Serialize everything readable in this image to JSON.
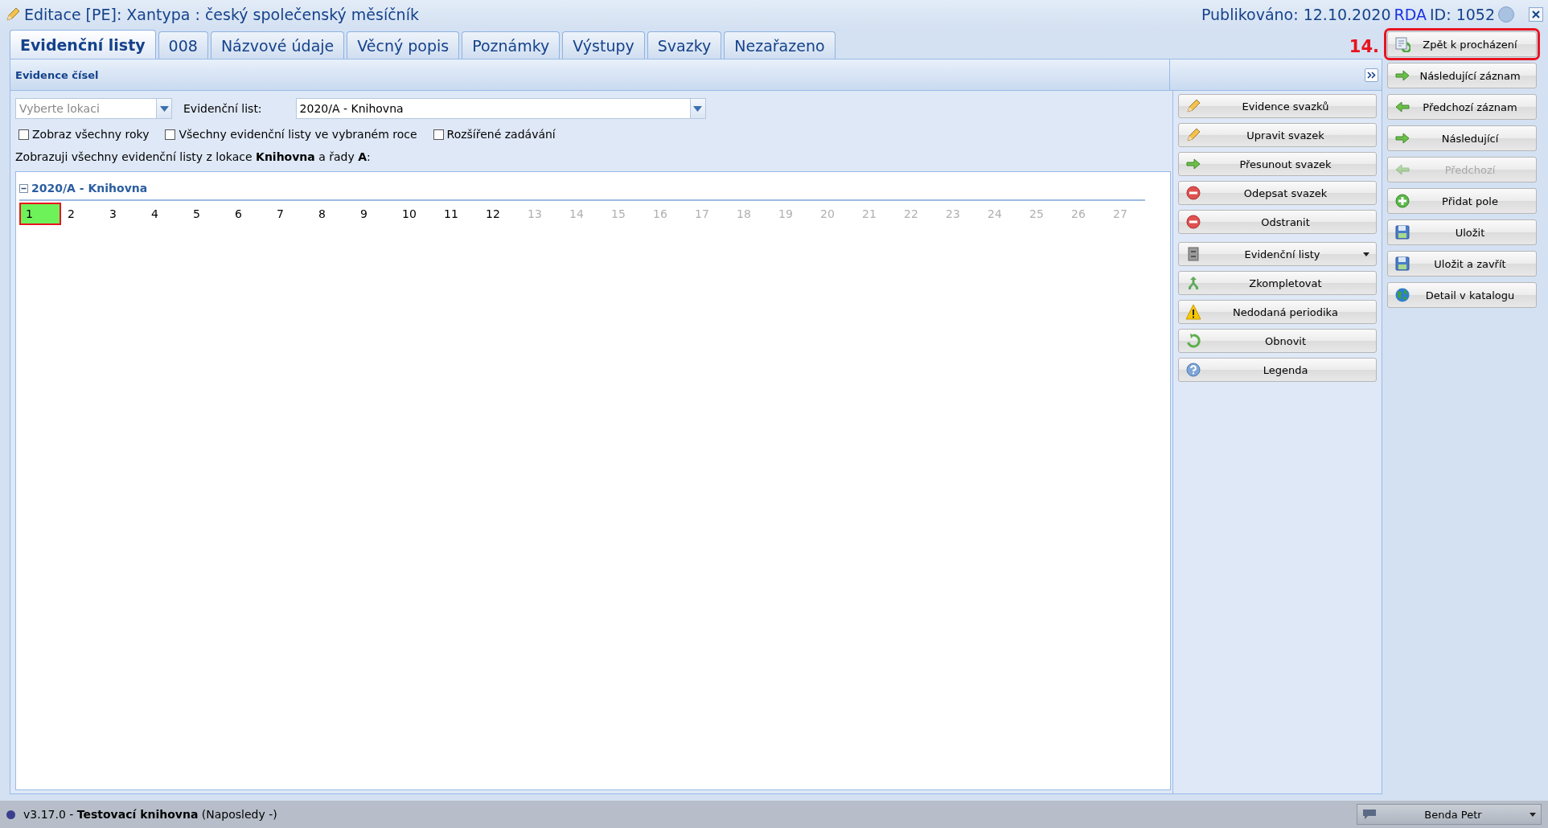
{
  "window": {
    "title": "Editace [PE]: Xantypa : český společenský měsíčník",
    "published": "Publikováno: 12.10.2020",
    "rda": "RDA",
    "record_id": "ID: 1052"
  },
  "tabs": [
    {
      "label": "Evidenční listy",
      "selected": true
    },
    {
      "label": "008",
      "selected": false
    },
    {
      "label": "Názvové údaje",
      "selected": false
    },
    {
      "label": "Věcný popis",
      "selected": false
    },
    {
      "label": "Poznámky",
      "selected": false
    },
    {
      "label": "Výstupy",
      "selected": false
    },
    {
      "label": "Svazky",
      "selected": false
    },
    {
      "label": "Nezařazeno",
      "selected": false
    }
  ],
  "step_label": "14.",
  "panel": {
    "title": "Evidence čísel",
    "location": {
      "placeholder": "Vyberte lokaci"
    },
    "list_label": "Evidenční list:",
    "list_value": "2020/A - Knihovna",
    "checkboxes": [
      {
        "label": "Zobraz všechny roky",
        "checked": false
      },
      {
        "label": "Všechny evidenční listy ve vybraném roce",
        "checked": false
      },
      {
        "label": "Rozšířené zadávání",
        "checked": false
      }
    ],
    "info": "Zobrazuji všechny evidenční listy z lokace **Knihovna** a řady **A**:",
    "group": {
      "label": "2020/A - Knihovna",
      "expanded": true,
      "issues": [
        {
          "label": "1",
          "selected": true,
          "disabled": false,
          "highlighted": true
        },
        {
          "label": "2",
          "selected": false,
          "disabled": false,
          "highlighted": false
        },
        {
          "label": "3",
          "selected": false,
          "disabled": false,
          "highlighted": false
        },
        {
          "label": "4",
          "selected": false,
          "disabled": false,
          "highlighted": false
        },
        {
          "label": "5",
          "selected": false,
          "disabled": false,
          "highlighted": false
        },
        {
          "label": "6",
          "selected": false,
          "disabled": false,
          "highlighted": false
        },
        {
          "label": "7",
          "selected": false,
          "disabled": false,
          "highlighted": false
        },
        {
          "label": "8",
          "selected": false,
          "disabled": false,
          "highlighted": false
        },
        {
          "label": "9",
          "selected": false,
          "disabled": false,
          "highlighted": false
        },
        {
          "label": "10",
          "selected": false,
          "disabled": false,
          "highlighted": false
        },
        {
          "label": "11",
          "selected": false,
          "disabled": false,
          "highlighted": false
        },
        {
          "label": "12",
          "selected": false,
          "disabled": false,
          "highlighted": false
        },
        {
          "label": "13",
          "selected": false,
          "disabled": true,
          "highlighted": false
        },
        {
          "label": "14",
          "selected": false,
          "disabled": true,
          "highlighted": false
        },
        {
          "label": "15",
          "selected": false,
          "disabled": true,
          "highlighted": false
        },
        {
          "label": "16",
          "selected": false,
          "disabled": true,
          "highlighted": false
        },
        {
          "label": "17",
          "selected": false,
          "disabled": true,
          "highlighted": false
        },
        {
          "label": "18",
          "selected": false,
          "disabled": true,
          "highlighted": false
        },
        {
          "label": "19",
          "selected": false,
          "disabled": true,
          "highlighted": false
        },
        {
          "label": "20",
          "selected": false,
          "disabled": true,
          "highlighted": false
        },
        {
          "label": "21",
          "selected": false,
          "disabled": true,
          "highlighted": false
        },
        {
          "label": "22",
          "selected": false,
          "disabled": true,
          "highlighted": false
        },
        {
          "label": "23",
          "selected": false,
          "disabled": true,
          "highlighted": false
        },
        {
          "label": "24",
          "selected": false,
          "disabled": true,
          "highlighted": false
        },
        {
          "label": "25",
          "selected": false,
          "disabled": true,
          "highlighted": false
        },
        {
          "label": "26",
          "selected": false,
          "disabled": true,
          "highlighted": false
        },
        {
          "label": "27",
          "selected": false,
          "disabled": true,
          "highlighted": false
        }
      ]
    }
  },
  "side_actions": [
    [
      {
        "label": "Evidence svazků",
        "kind": "pencil"
      },
      {
        "label": "Upravit svazek",
        "kind": "pencil"
      },
      {
        "label": "Přesunout svazek",
        "kind": "arrow-right"
      },
      {
        "label": "Odepsat svazek",
        "kind": "minus"
      },
      {
        "label": "Odstranit",
        "kind": "minus"
      }
    ],
    [
      {
        "label": "Evidenční listy",
        "kind": "cabinet",
        "dropdown": true
      },
      {
        "label": "Zkompletovat",
        "kind": "merge"
      },
      {
        "label": "Nedodaná periodika",
        "kind": "warning"
      },
      {
        "label": "Obnovit",
        "kind": "refresh"
      },
      {
        "label": "Legenda",
        "kind": "help"
      }
    ]
  ],
  "record_actions": [
    {
      "label": "Zpět k procházení",
      "kind": "back",
      "disabled": false,
      "highlighted": true
    },
    {
      "label": "Následující záznam",
      "kind": "arrow-right",
      "disabled": false,
      "highlighted": false
    },
    {
      "label": "Předchozí záznam",
      "kind": "arrow-left",
      "disabled": false,
      "highlighted": false
    },
    {
      "label": "Následující",
      "kind": "arrow-right",
      "disabled": false,
      "highlighted": false
    },
    {
      "label": "Předchozí",
      "kind": "arrow-left",
      "disabled": true,
      "highlighted": false
    },
    {
      "label": "Přidat pole",
      "kind": "plus",
      "disabled": false,
      "highlighted": false
    },
    {
      "label": "Uložit",
      "kind": "floppy",
      "disabled": false,
      "highlighted": false
    },
    {
      "label": "Uložit a zavřít",
      "kind": "floppy",
      "disabled": false,
      "highlighted": false
    },
    {
      "label": "Detail v katalogu",
      "kind": "globe",
      "disabled": false,
      "highlighted": false
    }
  ],
  "status_bar": {
    "version": "v3.17.0 - **Testovací knihovna** (Naposledy -)",
    "user": "Benda Petr"
  }
}
